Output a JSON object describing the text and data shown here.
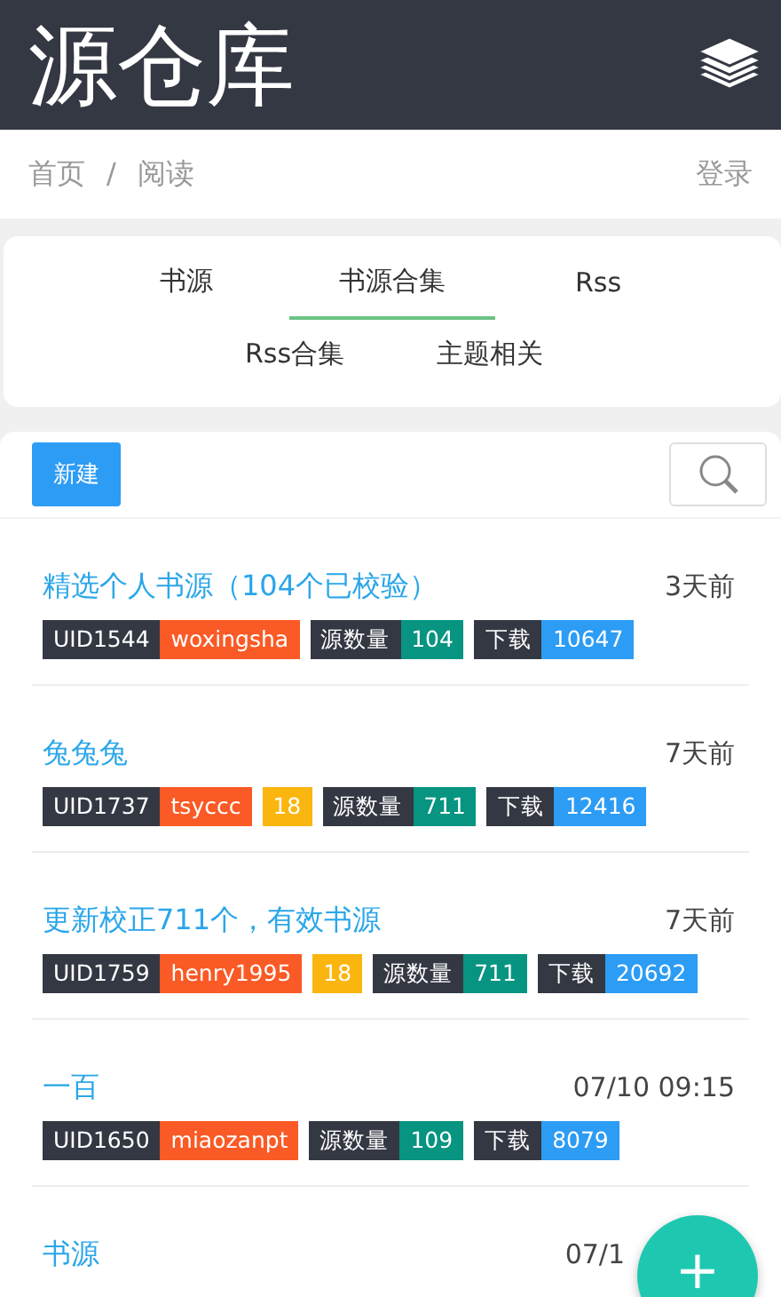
{
  "header": {
    "title": "源仓库"
  },
  "breadcrumb": {
    "items": [
      "首页",
      "阅读"
    ],
    "separator": "/",
    "login": "登录"
  },
  "tab_rows": [
    [
      {
        "label": "书源",
        "selected": false
      },
      {
        "label": "书源合集",
        "selected": true
      },
      {
        "label": "Rss",
        "selected": false
      }
    ],
    [
      {
        "label": "Rss合集",
        "selected": false
      },
      {
        "label": "主题相关",
        "selected": false
      }
    ]
  ],
  "toolbar": {
    "new_button": "新建"
  },
  "items": [
    {
      "title": "精选个人书源（104个已校验）",
      "time": "3天前",
      "tags": [
        {
          "kind": "uid",
          "text": "UID1544"
        },
        {
          "kind": "author",
          "text": "woxingsha"
        },
        {
          "kind": "label",
          "text": "源数量"
        },
        {
          "kind": "count",
          "text": "104"
        },
        {
          "kind": "label",
          "text": "下载"
        },
        {
          "kind": "downloads",
          "text": "10647"
        }
      ]
    },
    {
      "title": "兔兔兔",
      "time": "7天前",
      "tags": [
        {
          "kind": "uid",
          "text": "UID1737"
        },
        {
          "kind": "author",
          "text": "tsyccc"
        },
        {
          "kind": "rating",
          "text": "18"
        },
        {
          "kind": "label",
          "text": "源数量"
        },
        {
          "kind": "count",
          "text": "711"
        },
        {
          "kind": "label",
          "text": "下载"
        },
        {
          "kind": "downloads",
          "text": "12416"
        }
      ]
    },
    {
      "title": "更新校正711个，有效书源",
      "time": "7天前",
      "tags": [
        {
          "kind": "uid",
          "text": "UID1759"
        },
        {
          "kind": "author",
          "text": "henry1995"
        },
        {
          "kind": "rating",
          "text": "18"
        },
        {
          "kind": "label",
          "text": "源数量"
        },
        {
          "kind": "count",
          "text": "711"
        },
        {
          "kind": "label",
          "text": "下载"
        },
        {
          "kind": "downloads",
          "text": "20692"
        }
      ]
    },
    {
      "title": "一百",
      "time": "07/10 09:15",
      "tags": [
        {
          "kind": "uid",
          "text": "UID1650"
        },
        {
          "kind": "author",
          "text": "miaozanpt"
        },
        {
          "kind": "label",
          "text": "源数量"
        },
        {
          "kind": "count",
          "text": "109"
        },
        {
          "kind": "label",
          "text": "下载"
        },
        {
          "kind": "downloads",
          "text": "8079"
        }
      ]
    },
    {
      "title": "书源",
      "time": "07/1"
    }
  ],
  "fab": {
    "label": "+"
  }
}
